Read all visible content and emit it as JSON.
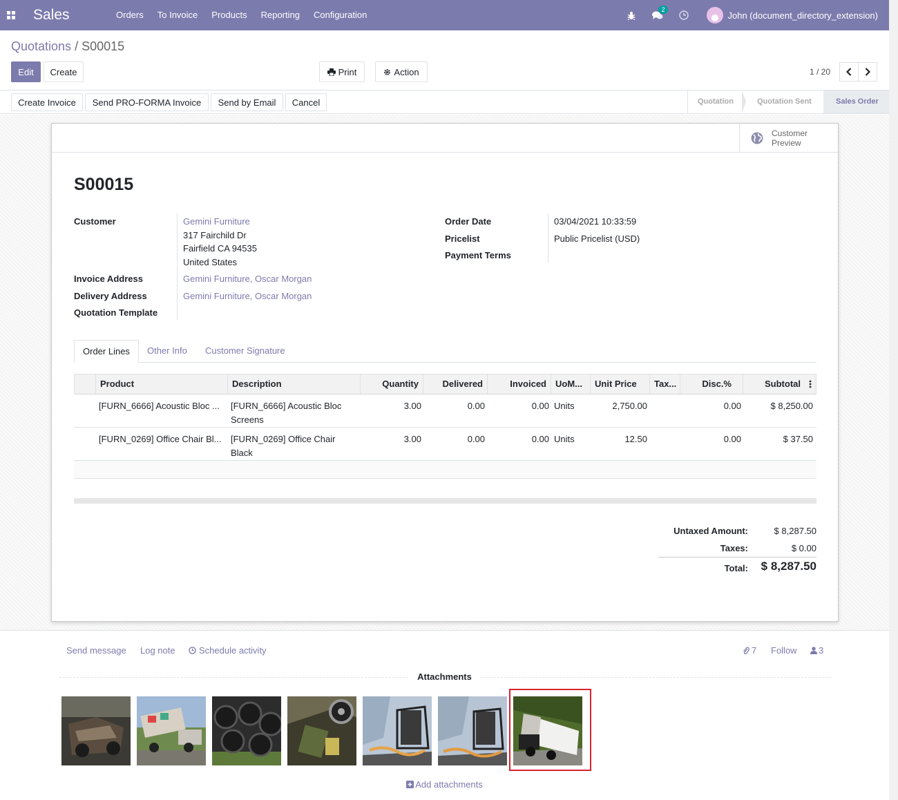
{
  "nav": {
    "app_name": "Sales",
    "menu": [
      "Orders",
      "To Invoice",
      "Products",
      "Reporting",
      "Configuration"
    ],
    "messages_count": "2",
    "user_name": "John (document_directory_extension)"
  },
  "breadcrumb": {
    "parent": "Quotations",
    "sep": " / ",
    "current": "S00015"
  },
  "toolbar": {
    "edit": "Edit",
    "create": "Create",
    "print": "Print",
    "action": "Action",
    "pager": "1 / 20"
  },
  "status_actions": [
    "Create Invoice",
    "Send PRO-FORMA Invoice",
    "Send by Email",
    "Cancel"
  ],
  "stages": [
    "Quotation",
    "Quotation Sent",
    "Sales Order"
  ],
  "active_stage": "Sales Order",
  "form": {
    "preview_label": "Customer Preview",
    "name": "S00015",
    "customer_label": "Customer",
    "customer_name": "Gemini Furniture",
    "address": [
      "317 Fairchild Dr",
      "Fairfield CA 94535",
      "United States"
    ],
    "invoice_address_label": "Invoice Address",
    "invoice_address": "Gemini Furniture, Oscar Morgan",
    "delivery_address_label": "Delivery Address",
    "delivery_address": "Gemini Furniture, Oscar Morgan",
    "template_label": "Quotation Template",
    "order_date_label": "Order Date",
    "order_date": "03/04/2021 10:33:59",
    "pricelist_label": "Pricelist",
    "pricelist": "Public Pricelist (USD)",
    "payment_terms_label": "Payment Terms"
  },
  "tabs": [
    "Order Lines",
    "Other Info",
    "Customer Signature"
  ],
  "table": {
    "headers": [
      "Product",
      "Description",
      "Quantity",
      "Delivered",
      "Invoiced",
      "UoM...",
      "Unit Price",
      "Tax...",
      "Disc.%",
      "Subtotal"
    ],
    "rows": [
      {
        "product": "[FURN_6666] Acoustic Bloc ...",
        "description": "[FURN_6666] Acoustic Bloc Screens",
        "quantity": "3.00",
        "delivered": "0.00",
        "invoiced": "0.00",
        "uom": "Units",
        "unit_price": "2,750.00",
        "tax": "",
        "disc": "0.00",
        "subtotal": "$ 8,250.00"
      },
      {
        "product": "[FURN_0269] Office Chair Bl...",
        "description": "[FURN_0269] Office Chair Black",
        "quantity": "3.00",
        "delivered": "0.00",
        "invoiced": "0.00",
        "uom": "Units",
        "unit_price": "12.50",
        "tax": "",
        "disc": "0.00",
        "subtotal": "$ 37.50"
      }
    ]
  },
  "totals": {
    "untaxed_label": "Untaxed Amount:",
    "untaxed": "$ 8,287.50",
    "taxes_label": "Taxes:",
    "taxes": "$ 0.00",
    "total_label": "Total:",
    "total": "$ 8,287.50"
  },
  "chatter": {
    "send_message": "Send message",
    "log_note": "Log note",
    "schedule": "Schedule activity",
    "attachments_count": "7",
    "follow": "Follow",
    "followers_count": "3",
    "attachments_title": "Attachments",
    "add_attachments": "Add attachments"
  },
  "colors": {
    "brand": "#7c7bad",
    "selection": "#d9232d"
  }
}
